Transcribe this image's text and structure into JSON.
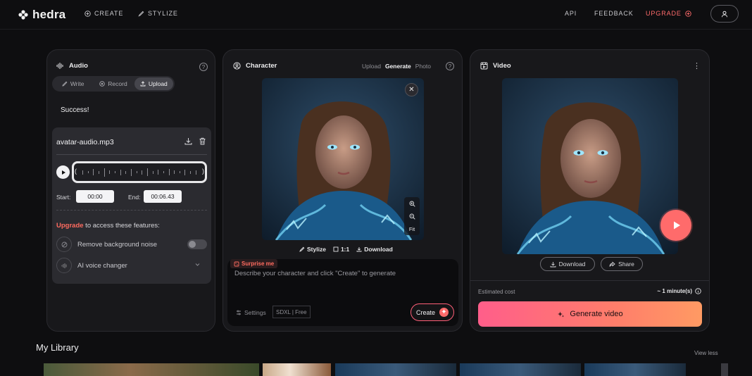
{
  "nav": {
    "logo": "hedra",
    "create": "CREATE",
    "stylize": "STYLIZE",
    "api": "API",
    "feedback": "FEEDBACK",
    "upgrade": "UPGRADE"
  },
  "audio": {
    "title": "Audio",
    "tabs": [
      "Write",
      "Record",
      "Upload"
    ],
    "active_tab": "Upload",
    "status": "Success!",
    "filename": "avatar-audio.mp3",
    "start_label": "Start:",
    "start_value": "00:00",
    "end_label": "End:",
    "end_value": "00:06.43",
    "upgrade_link": "Upgrade",
    "upgrade_text": " to access these features:",
    "features": [
      "Remove background noise",
      "AI voice changer"
    ]
  },
  "character": {
    "title": "Character",
    "tabs": [
      "Upload",
      "Generate",
      "Photo"
    ],
    "active_tab": "Generate",
    "tools": {
      "stylize": "Stylize",
      "ratio": "1:1",
      "download": "Download"
    },
    "fit": "Fit",
    "surprise": "Surprise me",
    "placeholder": "Describe your character and click \"Create\" to generate",
    "settings": "Settings",
    "model": "SDXL | Free",
    "create": "Create"
  },
  "video": {
    "title": "Video",
    "download": "Download",
    "share": "Share",
    "est_label": "Estimated cost",
    "est_value": "~ 1 minute(s)",
    "generate": "Generate video"
  },
  "library": {
    "title": "My Library",
    "view_less": "View less"
  },
  "colors": {
    "accent": "#ff6b6b",
    "gradient_start": "#ff5e8a",
    "gradient_end": "#ff9a63",
    "panel_bg": "#18181b"
  }
}
